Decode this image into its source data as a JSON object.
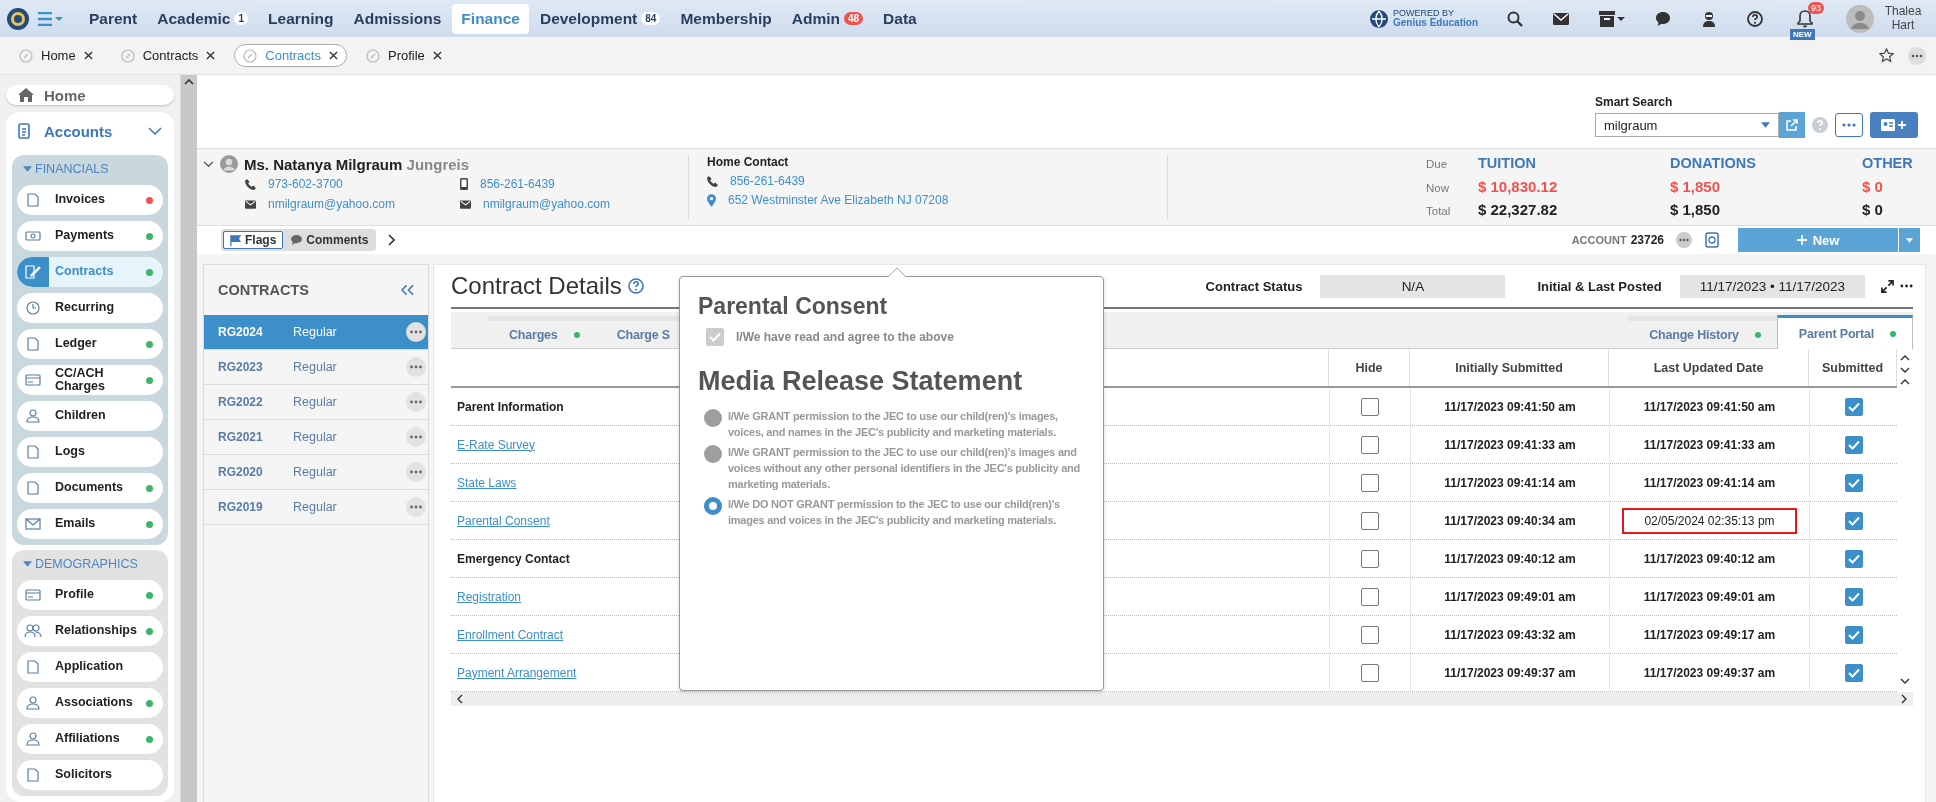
{
  "nav": {
    "items": [
      {
        "label": "Parent",
        "selected": false
      },
      {
        "label": "Academic",
        "badge": "1",
        "selected": false
      },
      {
        "label": "Learning",
        "selected": false
      },
      {
        "label": "Admissions",
        "selected": false
      },
      {
        "label": "Finance",
        "selected": true
      },
      {
        "label": "Development",
        "badge": "84",
        "selected": false
      },
      {
        "label": "Membership",
        "selected": false
      },
      {
        "label": "Admin",
        "badge": "48",
        "selected": false
      },
      {
        "label": "Data",
        "selected": false
      }
    ]
  },
  "powered_by": {
    "line1": "POWERED BY",
    "line2": "Genius Education"
  },
  "notifications": {
    "count": "93",
    "tag": "NEW"
  },
  "user": {
    "name": "Thalea Hart"
  },
  "open_tabs": [
    {
      "label": "Home",
      "selected": false
    },
    {
      "label": "Contracts",
      "selected": false
    },
    {
      "label": "Contracts",
      "selected": true
    },
    {
      "label": "Profile",
      "selected": false
    }
  ],
  "sidebar": {
    "home": "Home",
    "section": "Accounts",
    "groups": [
      {
        "title": "FINANCIALS",
        "items": [
          {
            "label": "Invoices",
            "selected": false,
            "color": "#ef5350"
          },
          {
            "label": "Payments",
            "selected": false,
            "color": "#3bb56b"
          },
          {
            "label": "Contracts",
            "selected": true,
            "color": "#3bb56b"
          },
          {
            "label": "Recurring",
            "selected": false
          },
          {
            "label": "Ledger",
            "selected": false,
            "color": "#3bb56b"
          },
          {
            "label": "CC/ACH Charges",
            "selected": false,
            "color": "#3bb56b"
          },
          {
            "label": "Children",
            "selected": false
          },
          {
            "label": "Logs",
            "selected": false
          },
          {
            "label": "Documents",
            "selected": false,
            "color": "#3bb56b"
          },
          {
            "label": "Emails",
            "selected": false,
            "color": "#3bb56b"
          }
        ]
      },
      {
        "title": "DEMOGRAPHICS",
        "items": [
          {
            "label": "Profile",
            "selected": false,
            "color": "#3bb56b"
          },
          {
            "label": "Relationships",
            "selected": false,
            "color": "#3bb56b"
          },
          {
            "label": "Application",
            "selected": false
          },
          {
            "label": "Associations",
            "selected": false,
            "color": "#3bb56b"
          },
          {
            "label": "Affiliations",
            "selected": false,
            "color": "#3bb56b"
          },
          {
            "label": "Solicitors",
            "selected": false
          }
        ]
      }
    ]
  },
  "smart_search": {
    "label": "Smart Search",
    "value": "milgraum"
  },
  "person": {
    "name": "Ms. Natanya Milgraum",
    "suffix": "Jungreis",
    "phones": [
      "973-602-3700",
      "856-261-6439"
    ],
    "emails": [
      "nmilgraum@yahoo.com",
      "nmilgraum@yahoo.com"
    ]
  },
  "home_contact": {
    "title": "Home Contact",
    "phone": "856-261-6439",
    "address": "652 Westminster Ave Elizabeth NJ 07208"
  },
  "balances": {
    "row_labels": [
      "Due",
      "Now",
      "Total"
    ],
    "columns": [
      {
        "title": "TUITION",
        "now": "$ 10,830.12",
        "total": "$ 22,327.82"
      },
      {
        "title": "DONATIONS",
        "now": "$ 1,850",
        "total": "$ 1,850"
      },
      {
        "title": "OTHER",
        "now": "$ 0",
        "total": "$ 0"
      }
    ]
  },
  "record_bar": {
    "flags": "Flags",
    "comments": "Comments",
    "account_label": "ACCOUNT",
    "account": "23726",
    "new_button": "New"
  },
  "contracts": {
    "title": "CONTRACTS",
    "items": [
      {
        "code": "RG2024",
        "type": "Regular",
        "selected": true
      },
      {
        "code": "RG2023",
        "type": "Regular",
        "selected": false
      },
      {
        "code": "RG2022",
        "type": "Regular",
        "selected": false
      },
      {
        "code": "RG2021",
        "type": "Regular",
        "selected": false
      },
      {
        "code": "RG2020",
        "type": "Regular",
        "selected": false
      },
      {
        "code": "RG2019",
        "type": "Regular",
        "selected": false
      }
    ]
  },
  "details": {
    "title": "Contract Details",
    "status_label": "Contract Status",
    "status": "N/A",
    "posted_label": "Initial & Last Posted",
    "posted": "11/17/2023 • 11/17/2023",
    "tabs": [
      {
        "label": "Charges",
        "dot": true,
        "selected": false
      },
      {
        "label": "Charge S",
        "dot": false,
        "selected": false
      },
      {
        "label": "Change History",
        "dot": true,
        "selected": false
      },
      {
        "label": "Parent Portal",
        "dot": true,
        "selected": true
      }
    ],
    "table": {
      "columns": [
        "Hide",
        "Initially Submitted",
        "Last Updated Date",
        "Submitted"
      ],
      "rows": [
        {
          "kind": "heading",
          "name": "Parent Information",
          "hidden": false,
          "initially": "11/17/2023 09:41:50 am",
          "updated": "11/17/2023 09:41:50 am",
          "highlighted": false,
          "submitted": true
        },
        {
          "kind": "link",
          "name": "E-Rate Survey",
          "hidden": false,
          "initially": "11/17/2023 09:41:33 am",
          "updated": "11/17/2023 09:41:33 am",
          "highlighted": false,
          "submitted": true
        },
        {
          "kind": "link",
          "name": "State Laws",
          "hidden": false,
          "initially": "11/17/2023 09:41:14 am",
          "updated": "11/17/2023 09:41:14 am",
          "highlighted": false,
          "submitted": true
        },
        {
          "kind": "link",
          "name": "Parental Consent",
          "hidden": false,
          "initially": "11/17/2023 09:40:34 am",
          "updated": "02/05/2024 02:35:13 pm",
          "highlighted": true,
          "submitted": true
        },
        {
          "kind": "heading",
          "name": "Emergency Contact",
          "hidden": false,
          "initially": "11/17/2023 09:40:12 am",
          "updated": "11/17/2023 09:40:12 am",
          "highlighted": false,
          "submitted": true
        },
        {
          "kind": "link",
          "name": "Registration",
          "hidden": false,
          "initially": "11/17/2023 09:49:01 am",
          "updated": "11/17/2023 09:49:01 am",
          "highlighted": false,
          "submitted": true
        },
        {
          "kind": "link",
          "name": "Enrollment Contract",
          "hidden": false,
          "initially": "11/17/2023 09:43:32 am",
          "updated": "11/17/2023 09:49:17 am",
          "highlighted": false,
          "submitted": true
        },
        {
          "kind": "link",
          "name": "Payment Arrangement",
          "hidden": false,
          "initially": "11/17/2023 09:49:37 am",
          "updated": "11/17/2023 09:49:37 am",
          "highlighted": false,
          "submitted": true
        }
      ]
    }
  },
  "popup": {
    "title": "Parental Consent",
    "agree": {
      "label": "I/We have read and agree to the above",
      "checked": true
    },
    "media_title": "Media Release Statement",
    "options": [
      {
        "text": "I/We GRANT permission to the JEC to use our child(ren)'s images, voices, and names in the JEC's publicity and marketing materials.",
        "selected": false
      },
      {
        "text": "I/We GRANT permission to the JEC to use our child(ren)'s images and voices without any other personal identifiers in the JEC's publicity and marketing materials.",
        "selected": false
      },
      {
        "text": "I/We DO NOT GRANT permission to the JEC to use our child(ren)'s images and voices in the JEC's publicity and marketing materials.",
        "selected": true
      }
    ]
  }
}
